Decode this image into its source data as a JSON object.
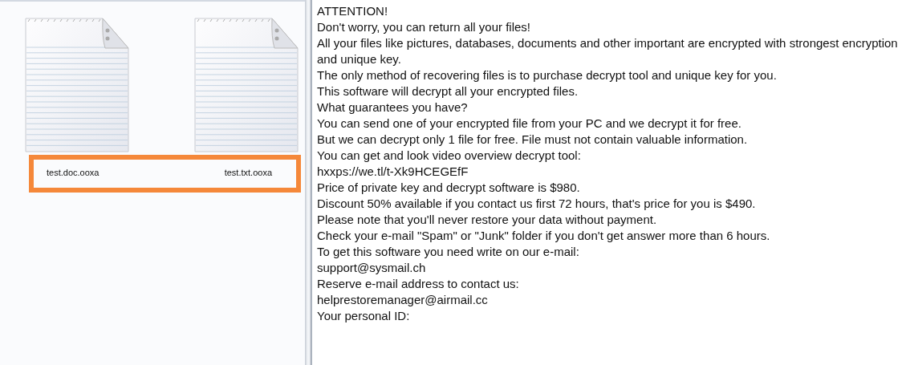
{
  "file_pane": {
    "highlighted": true,
    "files": [
      {
        "name": "test.doc.ooxa"
      },
      {
        "name": "test.txt.ooxa"
      }
    ]
  },
  "note": {
    "lines": [
      "ATTENTION!",
      "Don't worry, you can return all your files!",
      "All your files like pictures, databases, documents and other important are encrypted with strongest encryption and unique key.",
      "The only method of recovering files is to purchase decrypt tool and unique key for you.",
      "This software will decrypt all your encrypted files.",
      "What guarantees you have?",
      "You can send one of your encrypted file from your PC and we decrypt it for free.",
      "But we can decrypt only 1 file for free. File must not contain valuable information.",
      "You can get and look video overview decrypt tool:",
      "hxxps://we.tl/t-Xk9HCEGEfF",
      "Price of private key and decrypt software is $980.",
      "Discount 50% available if you contact us first 72 hours, that's price for you is $490.",
      "Please note that you'll never restore your data without payment.",
      "Check your e-mail \"Spam\" or \"Junk\" folder if you don't get answer more than 6 hours.",
      "To get this software you need write on our e-mail:",
      "support@sysmail.ch",
      "Reserve e-mail address to contact us:",
      "helprestoremanager@airmail.cc",
      "Your personal ID:"
    ]
  }
}
